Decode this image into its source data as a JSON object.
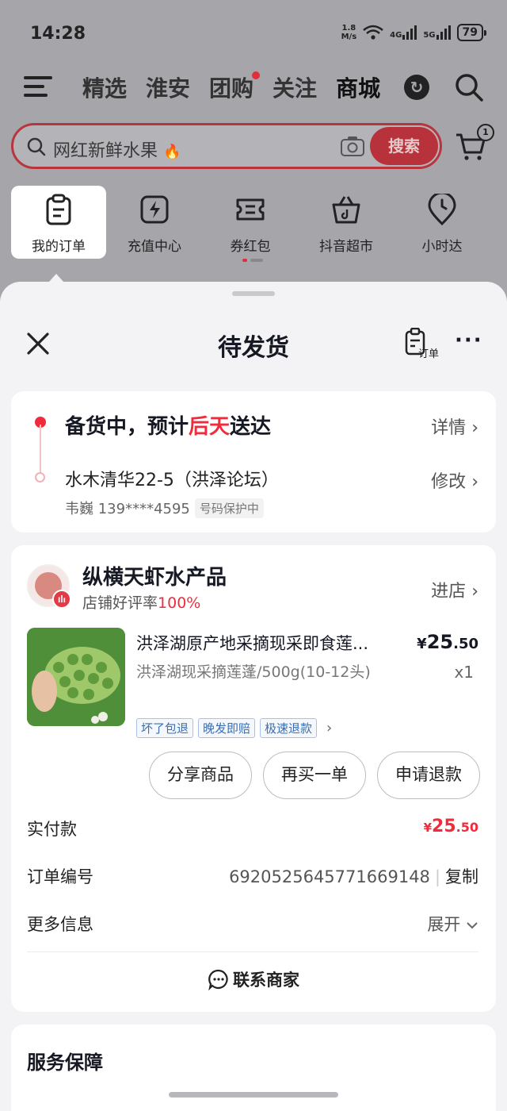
{
  "status_bar": {
    "time": "14:28",
    "net_speed_top": "1.8",
    "net_speed_bottom": "M/s",
    "sim1": "4G",
    "sim2": "5G",
    "battery": "79"
  },
  "top_nav": {
    "tabs": [
      "精选",
      "淮安",
      "团购",
      "关注",
      "商城"
    ],
    "active_tab": "商城"
  },
  "search": {
    "placeholder": "网红新鲜水果",
    "button": "搜索",
    "cart_badge": "1"
  },
  "quick_links": [
    "我的订单",
    "充值中心",
    "券红包",
    "抖音超市",
    "小时达"
  ],
  "sheet": {
    "title": "待发货",
    "order_icon_label": "订单",
    "more": "···"
  },
  "delivery": {
    "status_prefix": "备货中，预计",
    "status_highlight": "后天",
    "status_suffix": "送达",
    "details_link": "详情",
    "address": "水木清华22-5（洪泽论坛）",
    "edit_link": "修改",
    "contact": "韦巍 139****4595",
    "privacy_tag": "号码保护中"
  },
  "shop": {
    "name": "纵横天虾水产品",
    "rating_label": "店铺好评率",
    "rating_value": "100%",
    "enter_link": "进店"
  },
  "product": {
    "title": "洪泽湖原产地采摘现采即食莲...",
    "price_yen": "¥",
    "price_int": "25",
    "price_dec": ".50",
    "spec": "洪泽湖现采摘莲蓬/500g(10-12头)",
    "qty": "x1",
    "promos": [
      "坏了包退",
      "晚发即赔",
      "极速退款"
    ]
  },
  "actions": [
    "分享商品",
    "再买一单",
    "申请退款"
  ],
  "order_info": {
    "paid_label": "实付款",
    "paid_yen": "¥",
    "paid_int": "25",
    "paid_dec": ".50",
    "order_no_label": "订单编号",
    "order_no": "6920525645771669148",
    "copy": "复制",
    "more_info_label": "更多信息",
    "expand": "展开",
    "contact_merchant": "联系商家"
  },
  "service": {
    "title": "服务保障"
  },
  "colors": {
    "accent_red": "#f02c3c",
    "promo_blue": "#3d6eb0",
    "sheet_bg": "#f3f3f5"
  }
}
